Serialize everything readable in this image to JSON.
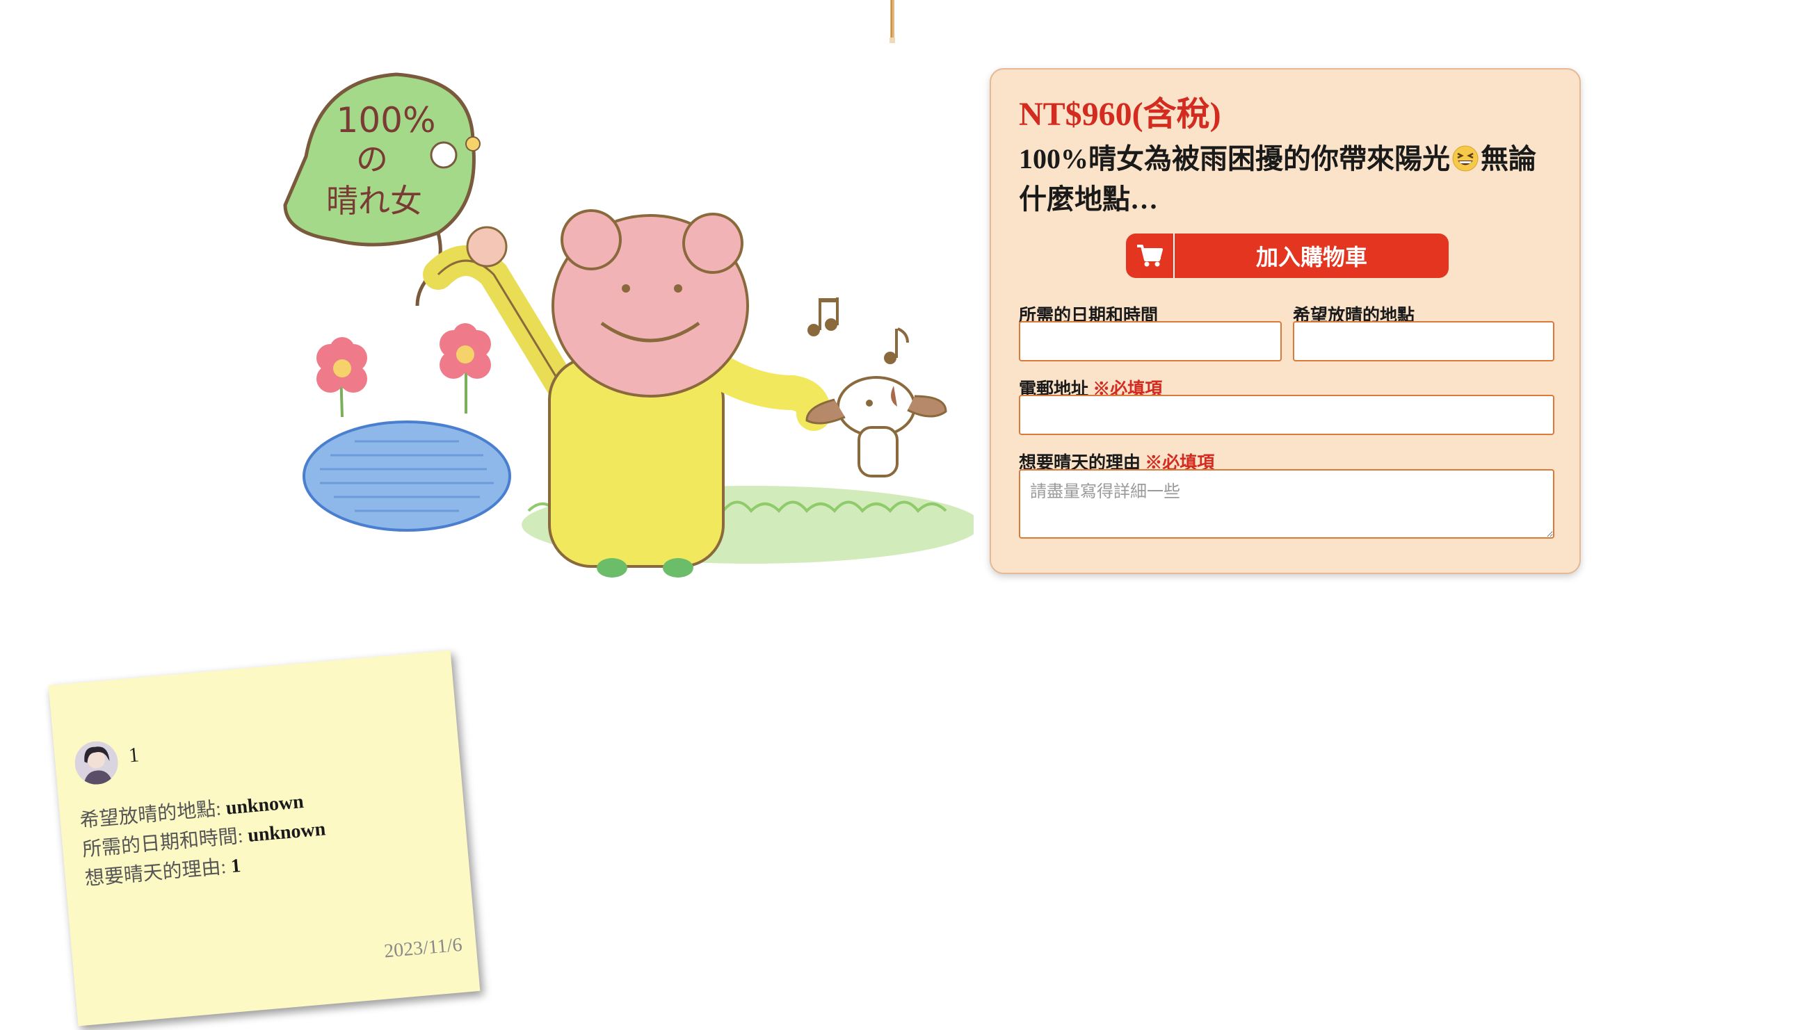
{
  "product": {
    "price": "NT$960(含稅)",
    "title_part1": "100%晴女為被雨困擾的你帶來陽光",
    "title_part2": "無論什麼地點…",
    "title_emoji": "grinning-squinting-face-icon",
    "add_to_cart_label": "加入購物車",
    "accent_color": "#e43521",
    "panel_color": "#fae3c9"
  },
  "illustration": {
    "leaf_text_line1": "100%",
    "leaf_text_line2": "の",
    "leaf_text_line3": "晴れ女"
  },
  "form": {
    "datetime_label": "所需的日期和時間",
    "location_label": "希望放晴的地點",
    "email_label": "電郵地址",
    "email_required": "※必填項",
    "reason_label": "想要晴天的理由",
    "reason_required": "※必填項",
    "reason_placeholder": "請盡量寫得詳細一些",
    "datetime_value": "",
    "location_value": "",
    "email_value": ""
  },
  "note": {
    "name": "1",
    "line1_label": "希望放晴的地點: ",
    "line1_value": "unknown",
    "line2_label": "所需的日期和時間: ",
    "line2_value": "unknown",
    "line3_label": "想要晴天的理由: ",
    "line3_value": "1",
    "date": "2023/11/6",
    "color": "#fcf9c5"
  }
}
